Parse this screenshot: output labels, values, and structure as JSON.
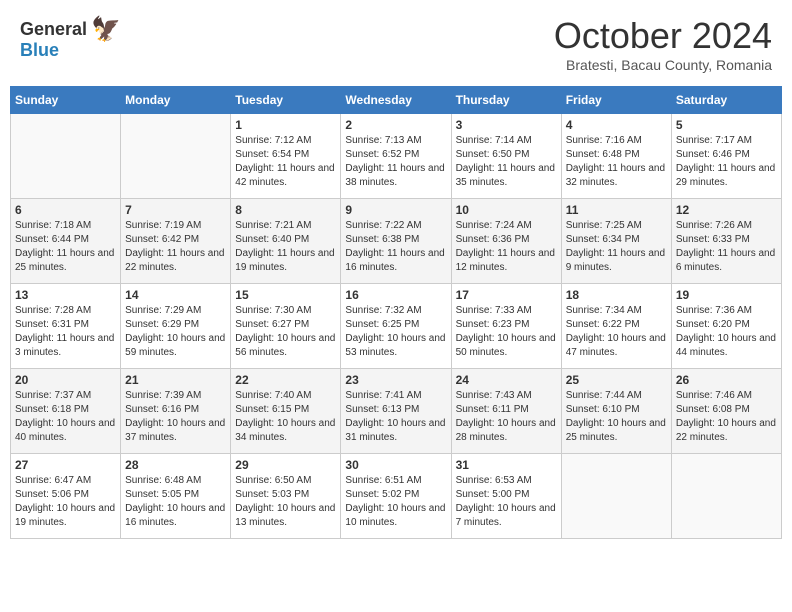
{
  "header": {
    "logo_general": "General",
    "logo_blue": "Blue",
    "month": "October 2024",
    "location": "Bratesti, Bacau County, Romania"
  },
  "days_of_week": [
    "Sunday",
    "Monday",
    "Tuesday",
    "Wednesday",
    "Thursday",
    "Friday",
    "Saturday"
  ],
  "weeks": [
    [
      {
        "day": "",
        "info": ""
      },
      {
        "day": "",
        "info": ""
      },
      {
        "day": "1",
        "info": "Sunrise: 7:12 AM\nSunset: 6:54 PM\nDaylight: 11 hours and 42 minutes."
      },
      {
        "day": "2",
        "info": "Sunrise: 7:13 AM\nSunset: 6:52 PM\nDaylight: 11 hours and 38 minutes."
      },
      {
        "day": "3",
        "info": "Sunrise: 7:14 AM\nSunset: 6:50 PM\nDaylight: 11 hours and 35 minutes."
      },
      {
        "day": "4",
        "info": "Sunrise: 7:16 AM\nSunset: 6:48 PM\nDaylight: 11 hours and 32 minutes."
      },
      {
        "day": "5",
        "info": "Sunrise: 7:17 AM\nSunset: 6:46 PM\nDaylight: 11 hours and 29 minutes."
      }
    ],
    [
      {
        "day": "6",
        "info": "Sunrise: 7:18 AM\nSunset: 6:44 PM\nDaylight: 11 hours and 25 minutes."
      },
      {
        "day": "7",
        "info": "Sunrise: 7:19 AM\nSunset: 6:42 PM\nDaylight: 11 hours and 22 minutes."
      },
      {
        "day": "8",
        "info": "Sunrise: 7:21 AM\nSunset: 6:40 PM\nDaylight: 11 hours and 19 minutes."
      },
      {
        "day": "9",
        "info": "Sunrise: 7:22 AM\nSunset: 6:38 PM\nDaylight: 11 hours and 16 minutes."
      },
      {
        "day": "10",
        "info": "Sunrise: 7:24 AM\nSunset: 6:36 PM\nDaylight: 11 hours and 12 minutes."
      },
      {
        "day": "11",
        "info": "Sunrise: 7:25 AM\nSunset: 6:34 PM\nDaylight: 11 hours and 9 minutes."
      },
      {
        "day": "12",
        "info": "Sunrise: 7:26 AM\nSunset: 6:33 PM\nDaylight: 11 hours and 6 minutes."
      }
    ],
    [
      {
        "day": "13",
        "info": "Sunrise: 7:28 AM\nSunset: 6:31 PM\nDaylight: 11 hours and 3 minutes."
      },
      {
        "day": "14",
        "info": "Sunrise: 7:29 AM\nSunset: 6:29 PM\nDaylight: 10 hours and 59 minutes."
      },
      {
        "day": "15",
        "info": "Sunrise: 7:30 AM\nSunset: 6:27 PM\nDaylight: 10 hours and 56 minutes."
      },
      {
        "day": "16",
        "info": "Sunrise: 7:32 AM\nSunset: 6:25 PM\nDaylight: 10 hours and 53 minutes."
      },
      {
        "day": "17",
        "info": "Sunrise: 7:33 AM\nSunset: 6:23 PM\nDaylight: 10 hours and 50 minutes."
      },
      {
        "day": "18",
        "info": "Sunrise: 7:34 AM\nSunset: 6:22 PM\nDaylight: 10 hours and 47 minutes."
      },
      {
        "day": "19",
        "info": "Sunrise: 7:36 AM\nSunset: 6:20 PM\nDaylight: 10 hours and 44 minutes."
      }
    ],
    [
      {
        "day": "20",
        "info": "Sunrise: 7:37 AM\nSunset: 6:18 PM\nDaylight: 10 hours and 40 minutes."
      },
      {
        "day": "21",
        "info": "Sunrise: 7:39 AM\nSunset: 6:16 PM\nDaylight: 10 hours and 37 minutes."
      },
      {
        "day": "22",
        "info": "Sunrise: 7:40 AM\nSunset: 6:15 PM\nDaylight: 10 hours and 34 minutes."
      },
      {
        "day": "23",
        "info": "Sunrise: 7:41 AM\nSunset: 6:13 PM\nDaylight: 10 hours and 31 minutes."
      },
      {
        "day": "24",
        "info": "Sunrise: 7:43 AM\nSunset: 6:11 PM\nDaylight: 10 hours and 28 minutes."
      },
      {
        "day": "25",
        "info": "Sunrise: 7:44 AM\nSunset: 6:10 PM\nDaylight: 10 hours and 25 minutes."
      },
      {
        "day": "26",
        "info": "Sunrise: 7:46 AM\nSunset: 6:08 PM\nDaylight: 10 hours and 22 minutes."
      }
    ],
    [
      {
        "day": "27",
        "info": "Sunrise: 6:47 AM\nSunset: 5:06 PM\nDaylight: 10 hours and 19 minutes."
      },
      {
        "day": "28",
        "info": "Sunrise: 6:48 AM\nSunset: 5:05 PM\nDaylight: 10 hours and 16 minutes."
      },
      {
        "day": "29",
        "info": "Sunrise: 6:50 AM\nSunset: 5:03 PM\nDaylight: 10 hours and 13 minutes."
      },
      {
        "day": "30",
        "info": "Sunrise: 6:51 AM\nSunset: 5:02 PM\nDaylight: 10 hours and 10 minutes."
      },
      {
        "day": "31",
        "info": "Sunrise: 6:53 AM\nSunset: 5:00 PM\nDaylight: 10 hours and 7 minutes."
      },
      {
        "day": "",
        "info": ""
      },
      {
        "day": "",
        "info": ""
      }
    ]
  ]
}
